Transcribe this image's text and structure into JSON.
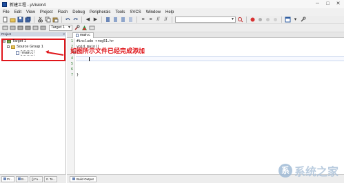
{
  "window": {
    "title": "新建工程 - µVision4",
    "minimize": "─",
    "maximize": "□",
    "close": "✕"
  },
  "menu": {
    "items": [
      "File",
      "Edit",
      "View",
      "Project",
      "Flash",
      "Debug",
      "Peripherals",
      "Tools",
      "SVCS",
      "Window",
      "Help"
    ]
  },
  "toolbar2": {
    "target_combo": "Target 1"
  },
  "project_panel": {
    "header": "Project",
    "close": "×",
    "tree": {
      "target": "Target 1",
      "group": "Source Group 1",
      "file": "main.c"
    },
    "tabs": [
      "Pr...",
      "B...",
      "{} Fu...",
      "0. Te..."
    ]
  },
  "editor": {
    "tab_label": "main.c",
    "lines": [
      {
        "num": "1",
        "text": "#include <reg51.h>"
      },
      {
        "num": "2",
        "text": "void main()"
      },
      {
        "num": "3",
        "text": "{"
      },
      {
        "num": "4",
        "text": ""
      },
      {
        "num": "5",
        "text": ""
      },
      {
        "num": "6",
        "text": ""
      },
      {
        "num": "7",
        "text": "}"
      }
    ],
    "fold_open": "−",
    "annotation": "如图所示文件已经完成添加"
  },
  "statusbar": {
    "tab_label": "Build Output"
  },
  "watermark": {
    "text": "系统之家"
  },
  "colors": {
    "annotation": "#e0161b",
    "line_numbers": "#2a7a2a"
  }
}
